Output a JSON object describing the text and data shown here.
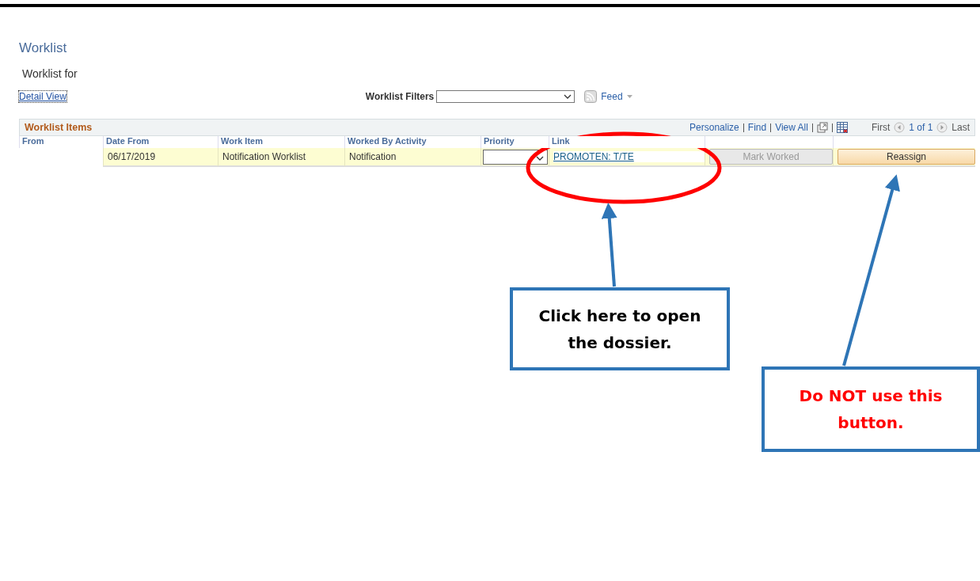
{
  "page": {
    "title": "Worklist",
    "subtitle": "Worklist for",
    "detail_view_link": "Detail View"
  },
  "filters": {
    "label": "Worklist Filters",
    "feed": "Feed"
  },
  "grid": {
    "title": "Worklist Items",
    "links": [
      "Personalize",
      "Find",
      "View All"
    ],
    "first": "First",
    "page_count": "1 of 1",
    "last": "Last",
    "columns": [
      "From",
      "Date From",
      "Work Item",
      "Worked By Activity",
      "Priority",
      "Link"
    ],
    "rows": [
      {
        "date_from": "06/17/2019",
        "work_item": "Notification Worklist",
        "worked_by_activity": "Notification",
        "link": "PROMOTEN: T/TE",
        "mark_worked": {
          "label": "Mark Worked",
          "disabled": true
        },
        "reassign": {
          "label": "Reassign",
          "disabled": false
        }
      }
    ]
  },
  "callouts": [
    {
      "text": "Click here to open the dossier.",
      "color": "#000000"
    },
    {
      "text": "Do NOT use this button.",
      "color": "#ff0000"
    }
  ]
}
